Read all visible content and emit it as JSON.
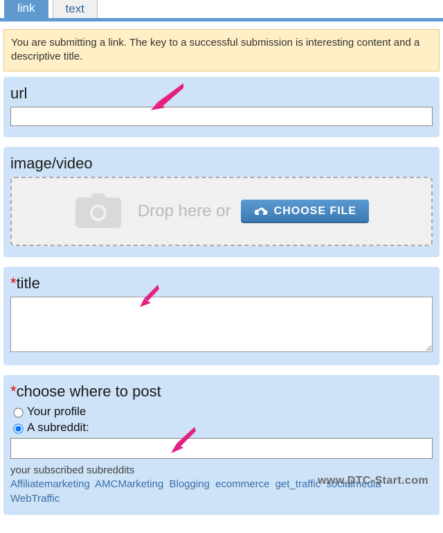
{
  "tabs": {
    "link": "link",
    "text": "text"
  },
  "info_text": "You are submitting a link. The key to a successful submission is interesting content and a descriptive title.",
  "url_panel": {
    "label": "url",
    "value": ""
  },
  "media_panel": {
    "label": "image/video",
    "drop_text": "Drop here or",
    "choose_label": "CHOOSE FILE"
  },
  "title_panel": {
    "label": "title",
    "value": ""
  },
  "post_panel": {
    "label": "choose where to post",
    "option_profile": "Your profile",
    "option_subreddit": "A subreddit:",
    "subreddit_value": "",
    "subscribed_label": "your subscribed subreddits",
    "subs": [
      "Affiliatemarketing",
      "AMCMarketing",
      "Blogging",
      "ecommerce",
      "get_traffic",
      "socialmedia",
      "WebTraffic"
    ]
  },
  "watermark": "www.DTC-Start.com"
}
